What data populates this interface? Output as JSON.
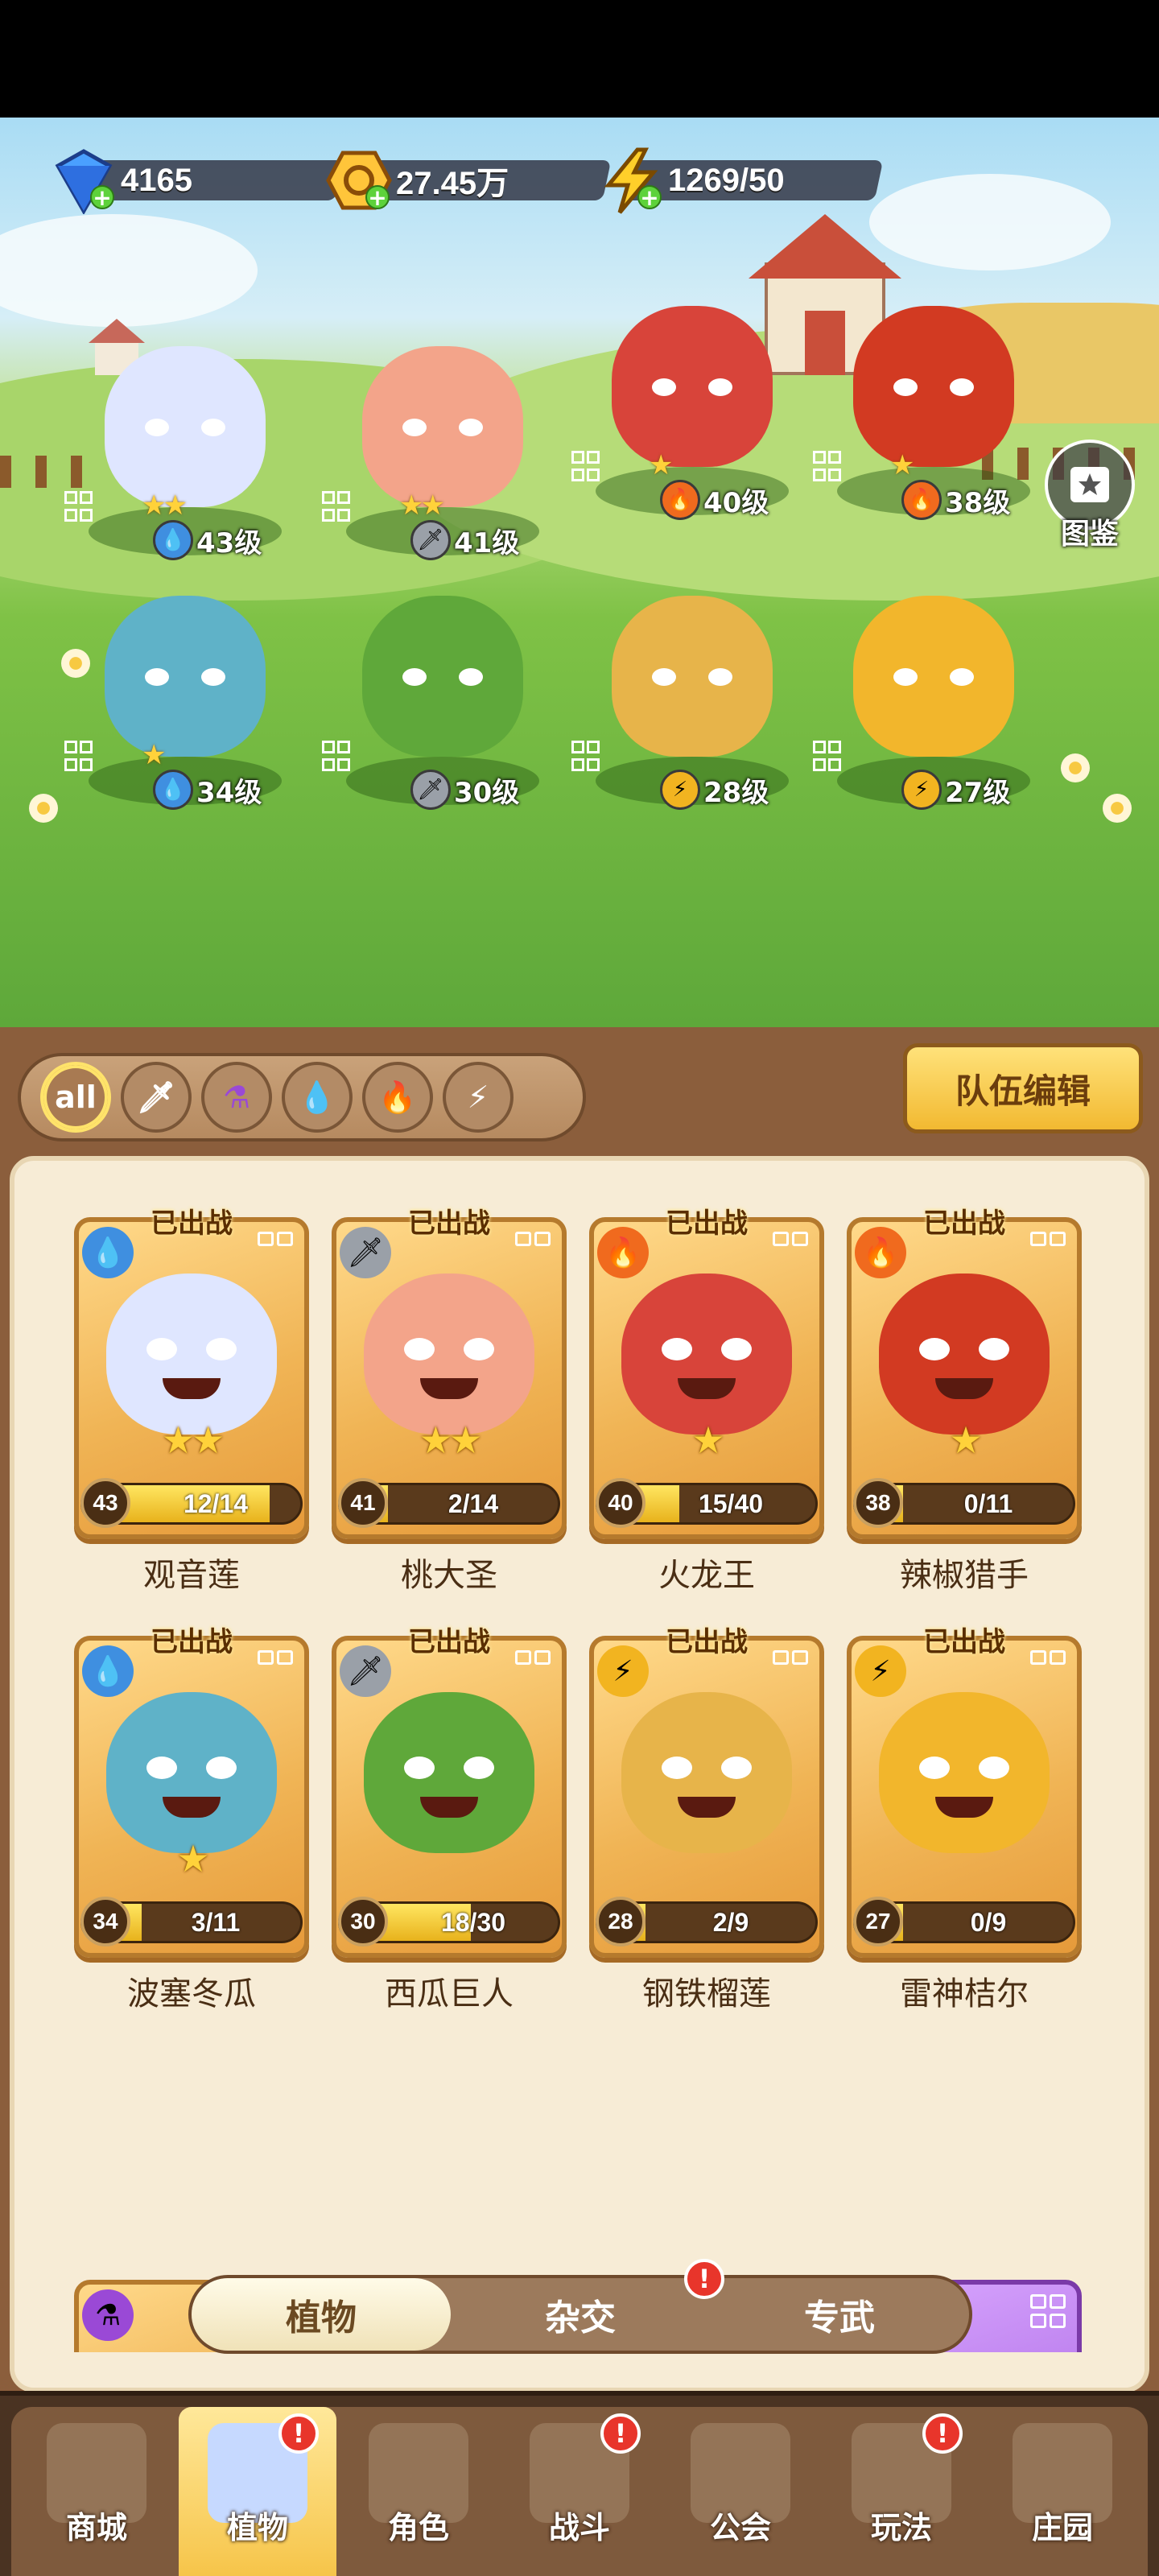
{
  "resources": {
    "gems": "4165",
    "coins": "27.45万",
    "energy": "1269/50"
  },
  "codex": {
    "label": "图鉴"
  },
  "lineup": [
    {
      "level": "43级",
      "element": "water",
      "stars": "★★"
    },
    {
      "level": "41级",
      "element": "sword",
      "stars": "★★"
    },
    {
      "level": "40级",
      "element": "fire",
      "stars": "★"
    },
    {
      "level": "38级",
      "element": "fire",
      "stars": "★"
    },
    {
      "level": "34级",
      "element": "water",
      "stars": "★"
    },
    {
      "level": "30级",
      "element": "sword",
      "stars": ""
    },
    {
      "level": "28级",
      "element": "thunder",
      "stars": ""
    },
    {
      "level": "27级",
      "element": "thunder",
      "stars": ""
    }
  ],
  "filters": [
    "all"
  ],
  "team_edit_label": "队伍编辑",
  "deployed_label": "已出战",
  "cards": [
    {
      "name": "观音莲",
      "level": "43",
      "progress": "12/14",
      "fill": 0.86,
      "element": "water",
      "stars": "★★",
      "deployed": true
    },
    {
      "name": "桃大圣",
      "level": "41",
      "progress": "2/14",
      "fill": 0.14,
      "element": "sword",
      "stars": "★★",
      "deployed": true
    },
    {
      "name": "火龙王",
      "level": "40",
      "progress": "15/40",
      "fill": 0.375,
      "element": "fire",
      "stars": "★",
      "deployed": true
    },
    {
      "name": "辣椒猎手",
      "level": "38",
      "progress": "0/11",
      "fill": 0,
      "element": "fire",
      "stars": "★",
      "deployed": true
    },
    {
      "name": "波塞冬瓜",
      "level": "34",
      "progress": "3/11",
      "fill": 0.27,
      "element": "water",
      "stars": "★",
      "deployed": true
    },
    {
      "name": "西瓜巨人",
      "level": "30",
      "progress": "18/30",
      "fill": 0.6,
      "element": "sword",
      "stars": "",
      "deployed": true
    },
    {
      "name": "钢铁榴莲",
      "level": "28",
      "progress": "2/9",
      "fill": 0.22,
      "element": "thunder",
      "stars": "",
      "deployed": true
    },
    {
      "name": "雷神桔尔",
      "level": "27",
      "progress": "0/9",
      "fill": 0,
      "element": "thunder",
      "stars": "",
      "deployed": true
    }
  ],
  "subtabs": [
    "植物",
    "杂交",
    "专武"
  ],
  "nav": [
    "商城",
    "植物",
    "角色",
    "战斗",
    "公会",
    "玩法",
    "庄园"
  ],
  "badge_mark": "!",
  "colors": {
    "water": "#3f8fe0",
    "sword": "#9aa0a8",
    "fire": "#f06a1e",
    "thunder": "#f2b420",
    "potion": "#9a49d6"
  }
}
